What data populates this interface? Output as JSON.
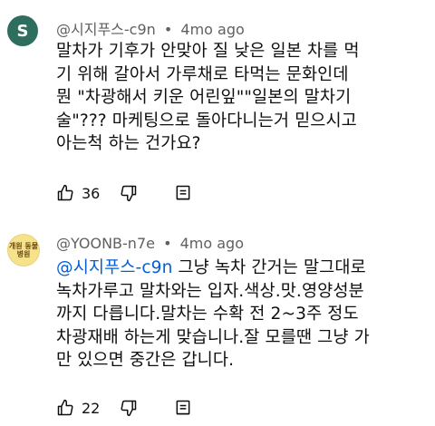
{
  "comments": [
    {
      "avatar_letter": "S",
      "author": "@시지푸스-c9n",
      "separator": "•",
      "time": "4mo ago",
      "lines": [
        "말차가 기후가 안맞아 질 낮은 일본 차를 먹",
        "기 위해 갈아서 가루채로 타먹는 문화인데",
        "뭔 \"차광해서 키운 어린잎\"\"일본의 말차기",
        "술\"??? 마케팅으로 돌아다니는거 믿으시고",
        "아는척 하는 건가요?"
      ],
      "likes": "36"
    },
    {
      "avatar_text": "개원 동물 병원",
      "author": "@YOONB-n7e",
      "separator": "•",
      "time": "4mo ago",
      "mention": "@시지푸스-c9n",
      "first_line_rest": " 그냥 녹차 간거는 말그대로",
      "lines": [
        "녹차가루고 말차와는 입자.색상.맛.영양성분",
        "까지 다릅니다.말차는 수확 전 2~3주 정도",
        "차광재배 하는게 맞습니나.잘 모를땐 그냥 가",
        "만 있으면 중간은 갑니다."
      ],
      "likes": "22"
    }
  ],
  "colors": {
    "mention": "#065fd4",
    "meta": "#606060",
    "text": "#0f0f0f"
  },
  "icons": [
    "thumb-up-icon",
    "thumb-down-icon",
    "reply-icon"
  ]
}
